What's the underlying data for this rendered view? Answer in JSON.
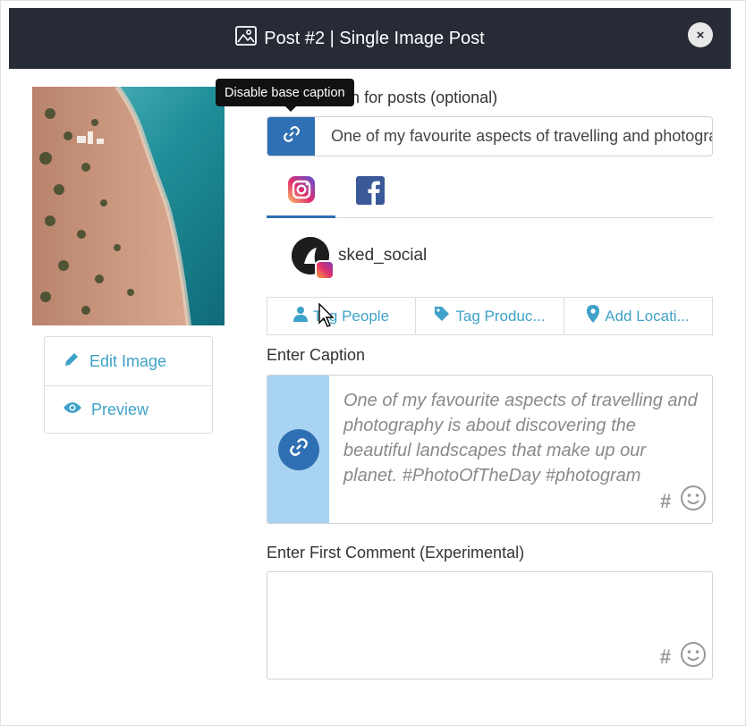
{
  "header": {
    "title": "Post #2 | Single Image Post",
    "close_label": "×"
  },
  "image_actions": {
    "edit_label": "Edit Image",
    "preview_label": "Preview"
  },
  "tooltip": {
    "text": "Disable base caption"
  },
  "base_caption": {
    "label": "Base caption for posts (optional)",
    "value": "One of my favourite aspects of travelling and photography"
  },
  "tabs": [
    {
      "name": "Instagram",
      "active": true
    },
    {
      "name": "Facebook",
      "active": false
    }
  ],
  "account": {
    "username": "sked_social"
  },
  "tag_buttons": {
    "tag_people": "Tag People",
    "tag_products": "Tag Produc...",
    "add_location": "Add Locati..."
  },
  "caption": {
    "label": "Enter Caption",
    "text": "One of my favourite aspects of travelling and photography is about discovering the beautiful landscapes that make up our planet. #PhotoOfTheDay #photogram",
    "hashtag_symbol": "#"
  },
  "first_comment": {
    "label": "Enter First Comment (Experimental)",
    "value": "",
    "hashtag_symbol": "#"
  },
  "colors": {
    "header_bg": "#262b36",
    "accent_blue": "#2f6fb3",
    "link_text": "#3fa2c8",
    "caption_side": "#a9d3f2"
  }
}
